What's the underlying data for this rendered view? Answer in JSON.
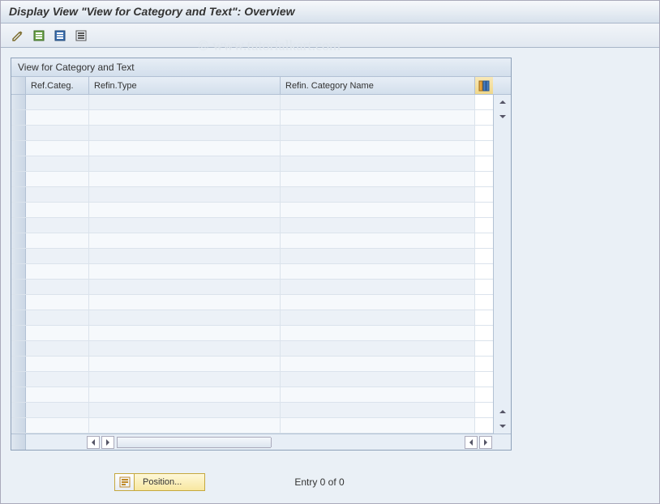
{
  "titlebar": {
    "text": "Display View \"View for Category and Text\": Overview"
  },
  "grid": {
    "title": "View for Category and Text",
    "columns": {
      "c1": "Ref.Categ.",
      "c2": "Refin.Type",
      "c3": "Refin. Category Name"
    }
  },
  "footer": {
    "position_label": "Position...",
    "entry_text": "Entry 0 of 0"
  },
  "watermark": "© www.tutorialkart.com"
}
